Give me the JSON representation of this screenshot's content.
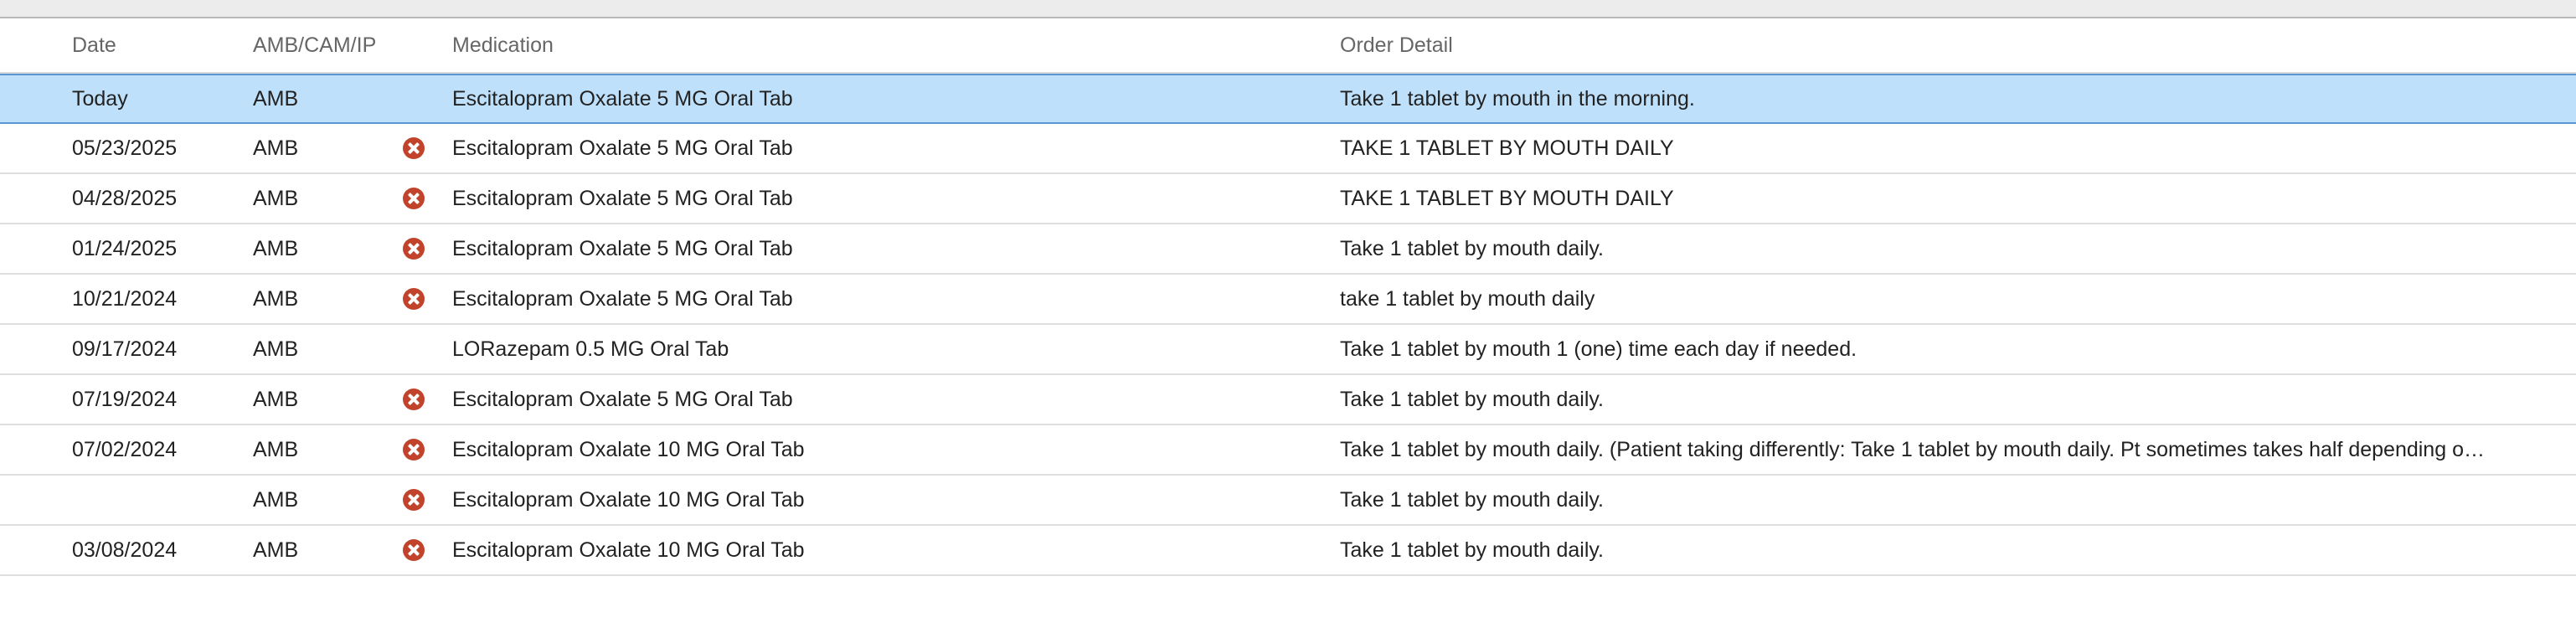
{
  "columns": {
    "date": "Date",
    "amb": "AMB/CAM/IP",
    "medication": "Medication",
    "order_detail": "Order Detail"
  },
  "rows": [
    {
      "date": "Today",
      "amb": "AMB",
      "discontinued": false,
      "medication": "Escitalopram Oxalate 5 MG Oral Tab",
      "order": "Take 1 tablet by mouth in the morning.",
      "selected": true
    },
    {
      "date": "05/23/2025",
      "amb": "AMB",
      "discontinued": true,
      "medication": "Escitalopram Oxalate 5 MG Oral Tab",
      "order": "TAKE 1 TABLET BY MOUTH DAILY",
      "selected": false
    },
    {
      "date": "04/28/2025",
      "amb": "AMB",
      "discontinued": true,
      "medication": "Escitalopram Oxalate 5 MG Oral Tab",
      "order": "TAKE 1 TABLET BY MOUTH DAILY",
      "selected": false
    },
    {
      "date": "01/24/2025",
      "amb": "AMB",
      "discontinued": true,
      "medication": "Escitalopram Oxalate 5 MG Oral Tab",
      "order": "Take 1 tablet by mouth daily.",
      "selected": false
    },
    {
      "date": "10/21/2024",
      "amb": "AMB",
      "discontinued": true,
      "medication": "Escitalopram Oxalate 5 MG Oral Tab",
      "order": "take 1 tablet by mouth daily",
      "selected": false
    },
    {
      "date": "09/17/2024",
      "amb": "AMB",
      "discontinued": false,
      "medication": "LORazepam 0.5 MG Oral Tab",
      "order": "Take 1 tablet by mouth 1 (one) time each day if needed.",
      "selected": false
    },
    {
      "date": "07/19/2024",
      "amb": "AMB",
      "discontinued": true,
      "medication": "Escitalopram Oxalate 5 MG Oral Tab",
      "order": "Take 1 tablet by mouth daily.",
      "selected": false
    },
    {
      "date": "07/02/2024",
      "amb": "AMB",
      "discontinued": true,
      "medication": "Escitalopram Oxalate 10 MG Oral Tab",
      "order": "Take 1 tablet by mouth daily. (Patient taking differently: Take 1 tablet by mouth daily. Pt sometimes takes half depending o…",
      "selected": false
    },
    {
      "date": "",
      "amb": "AMB",
      "discontinued": true,
      "medication": "Escitalopram Oxalate 10 MG Oral Tab",
      "order": "Take 1 tablet by mouth daily.",
      "selected": false
    },
    {
      "date": "03/08/2024",
      "amb": "AMB",
      "discontinued": true,
      "medication": "Escitalopram Oxalate 10 MG Oral Tab",
      "order": "Take 1 tablet by mouth daily.",
      "selected": false
    }
  ],
  "icons": {
    "discontinued": "x-circle-icon"
  },
  "colors": {
    "selected_row_bg": "#bfe0fb",
    "selected_row_border": "#5b95d6",
    "discontinued_icon": "#c2432b"
  }
}
